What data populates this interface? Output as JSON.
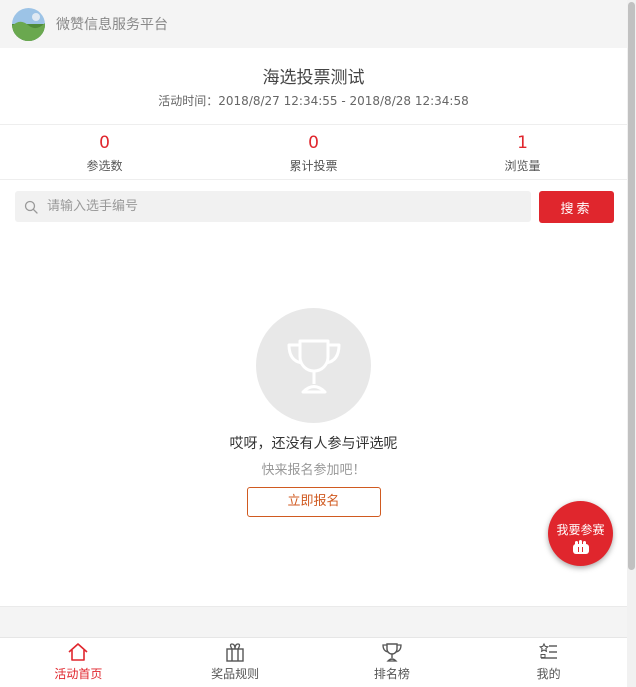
{
  "org": {
    "name": "微赞信息服务平台"
  },
  "activity": {
    "title": "海选投票测试",
    "time_text": "活动时间：2018/8/27 12:34:55 - 2018/8/28 12:34:58"
  },
  "stats": [
    {
      "value": "0",
      "label": "参选数"
    },
    {
      "value": "0",
      "label": "累计投票"
    },
    {
      "value": "1",
      "label": "浏览量"
    }
  ],
  "search": {
    "placeholder": "请输入选手编号",
    "value": "",
    "button_label": "搜索"
  },
  "empty_state": {
    "message": "哎呀，还没有人参与评选呢",
    "sub_message": "快来报名参加吧！",
    "button_label": "立即报名"
  },
  "fab": {
    "label": "我要参赛"
  },
  "tabs": [
    {
      "label": "活动首页",
      "icon": "home-icon",
      "active": true
    },
    {
      "label": "奖品规则",
      "icon": "gift-icon",
      "active": false
    },
    {
      "label": "排名榜",
      "icon": "trophy-icon",
      "active": false
    },
    {
      "label": "我的",
      "icon": "user-list-icon",
      "active": false
    }
  ],
  "colors": {
    "accent": "#e0262d",
    "signup_border": "#d05a20"
  }
}
